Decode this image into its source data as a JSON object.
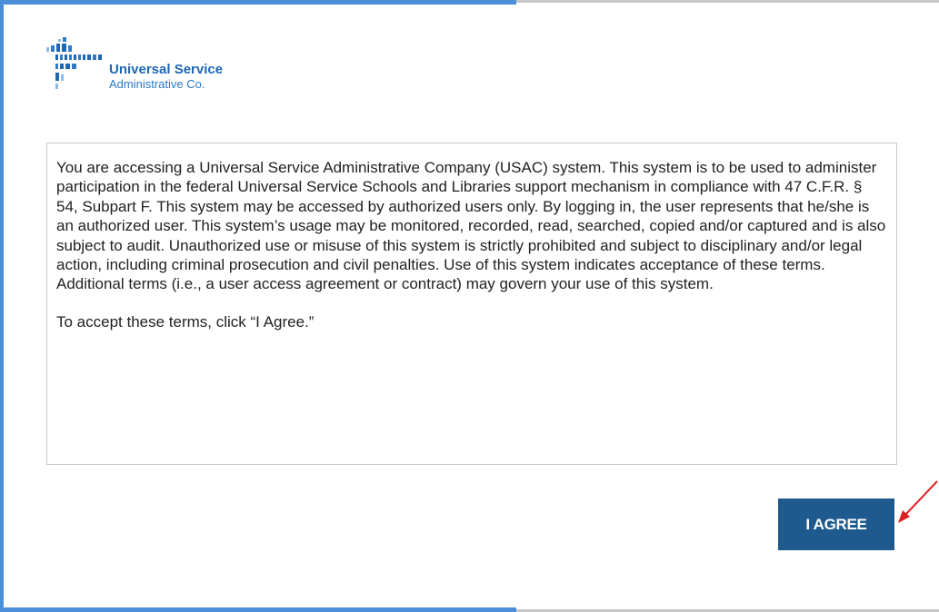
{
  "logo": {
    "line1": "Universal Service",
    "line2": "Administrative Co."
  },
  "terms": {
    "paragraph": "You are accessing a Universal Service Administrative Company (USAC) system. This system is to be used to administer participation in the federal Universal Service Schools and Libraries support mechanism in compliance with 47 C.F.R. § 54, Subpart F.  This system may be accessed by authorized users only.  By logging in, the user represents that he/she is an authorized user.  This system’s usage may be monitored, recorded, read, searched, copied and/or captured and is also subject to audit. Unauthorized use or misuse of this system is strictly prohibited and subject to disciplinary and/or legal action, including criminal prosecution and civil penalties.  Use of this system indicates acceptance of these terms.  Additional terms (i.e., a user access agreement or contract) may govern your use of this system.",
    "accept_instruction": "To accept these terms, click “I Agree.”"
  },
  "agree_button": {
    "label": "I AGREE"
  },
  "colors": {
    "frame_accent": "#4a8fd8",
    "button_bg": "#1e5a8e",
    "brand_blue": "#1f66b3",
    "annotation_arrow": "#e02020"
  },
  "icons": {
    "logo_mark": "usac-logo-icon",
    "annotation": "red-arrow-icon"
  }
}
